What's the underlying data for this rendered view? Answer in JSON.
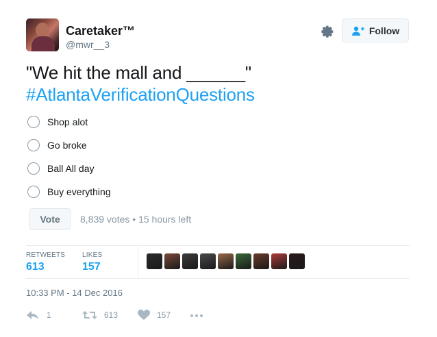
{
  "user": {
    "name": "Caretaker™",
    "handle": "@mwr__3"
  },
  "follow_button": {
    "label": "Follow"
  },
  "tweet": {
    "text": "\"We hit the mall and ______\"",
    "hashtag": "#AtlantaVerificationQuestions"
  },
  "poll": {
    "options": [
      "Shop alot",
      "Go broke",
      "Ball All day",
      "Buy everything"
    ],
    "vote_label": "Vote",
    "meta": "8,839 votes • 15 hours left"
  },
  "stats": {
    "retweets_label": "RETWEETS",
    "retweets_count": "613",
    "likes_label": "LIKES",
    "likes_count": "157"
  },
  "likers_colors": [
    "#2b2b2b",
    "#7a4a3a",
    "#3b3b3b",
    "#4a4a4a",
    "#9a6a4a",
    "#3a6a3a",
    "#6a3a2a",
    "#b03a3a",
    "#2a1a1a"
  ],
  "timestamp": "10:33 PM - 14 Dec 2016",
  "actions": {
    "reply_count": "1",
    "retweet_count": "613",
    "like_count": "157"
  },
  "colors": {
    "accent": "#1da1f2",
    "muted": "#8899a6",
    "text": "#14171a"
  }
}
